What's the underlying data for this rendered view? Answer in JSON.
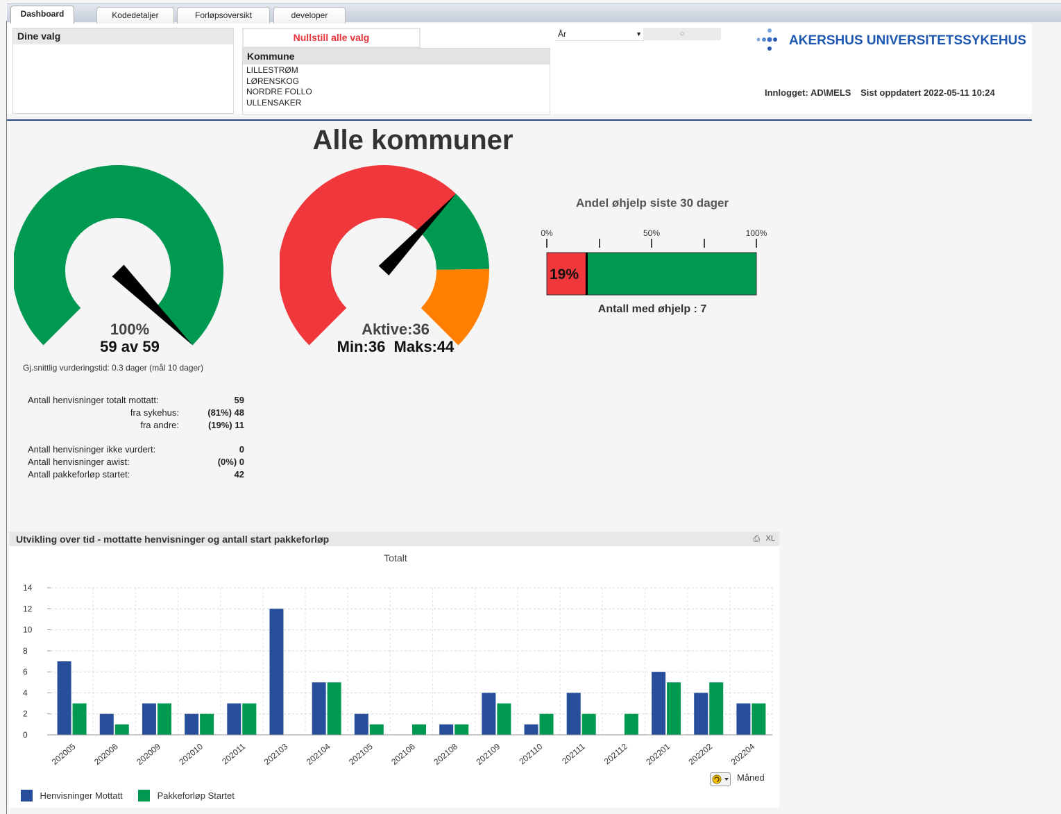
{
  "tabs": [
    {
      "label": "Dashboard",
      "active": true
    },
    {
      "label": "Kodedetaljer",
      "active": false
    },
    {
      "label": "Forløpsoversikt",
      "active": false
    },
    {
      "label": "developer",
      "active": false
    }
  ],
  "selections": {
    "title": "Dine valg"
  },
  "reset_button": "Nullstill alle valg",
  "kommune": {
    "title": "Kommune",
    "items": [
      "LILLESTRØM",
      "LØRENSKOG",
      "NORDRE FOLLO",
      "ULLENSAKER"
    ]
  },
  "year_select": {
    "value": "År"
  },
  "logo": {
    "text": "AKERSHUS UNIVERSITETSSYKEHUS"
  },
  "login": {
    "user_label": "Innlogget: AD\\MELS",
    "updated_label": "Sist oppdatert 2022-05-11 10:24"
  },
  "page_title": "Alle kommuner",
  "gauge1": {
    "percent_label": "100%",
    "count_label": "59 av 59",
    "value": 1.0,
    "color": "#009951"
  },
  "gauge1_note": "Gj.snittlig vurderingstid: 0.3 dager (mål 10 dager)",
  "gauge2": {
    "active_label": "Aktive:36",
    "minmax_label": "Min:36  Maks:44",
    "value": 36,
    "min": 36,
    "max": 44,
    "colors": {
      "red": "#f0383c",
      "green": "#009951",
      "orange": "#ff8000"
    }
  },
  "ohjelp": {
    "title": "Andel øhjelp siste 30 dager",
    "ticks": [
      "0%",
      "50%",
      "100%"
    ],
    "value_label": "19%",
    "value": 0.19,
    "count_label": "Antall med øhjelp : 7"
  },
  "stats": {
    "group1": [
      {
        "label": "Antall henvisninger totalt mottatt:",
        "value": "59"
      },
      {
        "label": "fra sykehus:",
        "value": "(81%) 48"
      },
      {
        "label": "fra andre:",
        "value": "(19%) 11"
      }
    ],
    "group2": [
      {
        "label": "Antall henvisninger ikke vurdert:",
        "value": "0"
      },
      {
        "label": "Antall henvisninger awist:",
        "value": "(0%) 0"
      },
      {
        "label": "Antall pakkeforløp startet:",
        "value": "42"
      }
    ]
  },
  "chart_panel": {
    "title": "Utvikling over tid - mottatte henvisninger og antall start pakkeforløp",
    "xl_label": "XL",
    "dimension_label": "Måned"
  },
  "chart_data": {
    "type": "bar",
    "title": "Totalt",
    "categories": [
      "202005",
      "202006",
      "202009",
      "202010",
      "202011",
      "202103",
      "202104",
      "202105",
      "202106",
      "202108",
      "202109",
      "202110",
      "202111",
      "202112",
      "202201",
      "202202",
      "202204"
    ],
    "series": [
      {
        "name": "Henvisninger Mottatt",
        "color": "#264e9b",
        "values": [
          7,
          2,
          3,
          2,
          3,
          12,
          5,
          2,
          0,
          1,
          4,
          1,
          4,
          0,
          6,
          4,
          3
        ]
      },
      {
        "name": "Pakkeforløp Startet",
        "color": "#009951",
        "values": [
          3,
          1,
          3,
          2,
          3,
          0,
          5,
          1,
          1,
          1,
          3,
          2,
          2,
          2,
          5,
          5,
          3
        ]
      }
    ],
    "y_ticks": [
      0,
      2,
      4,
      6,
      8,
      10,
      12,
      14
    ],
    "ylim": [
      0,
      14
    ],
    "grid": true,
    "legend": "bottom-left"
  }
}
